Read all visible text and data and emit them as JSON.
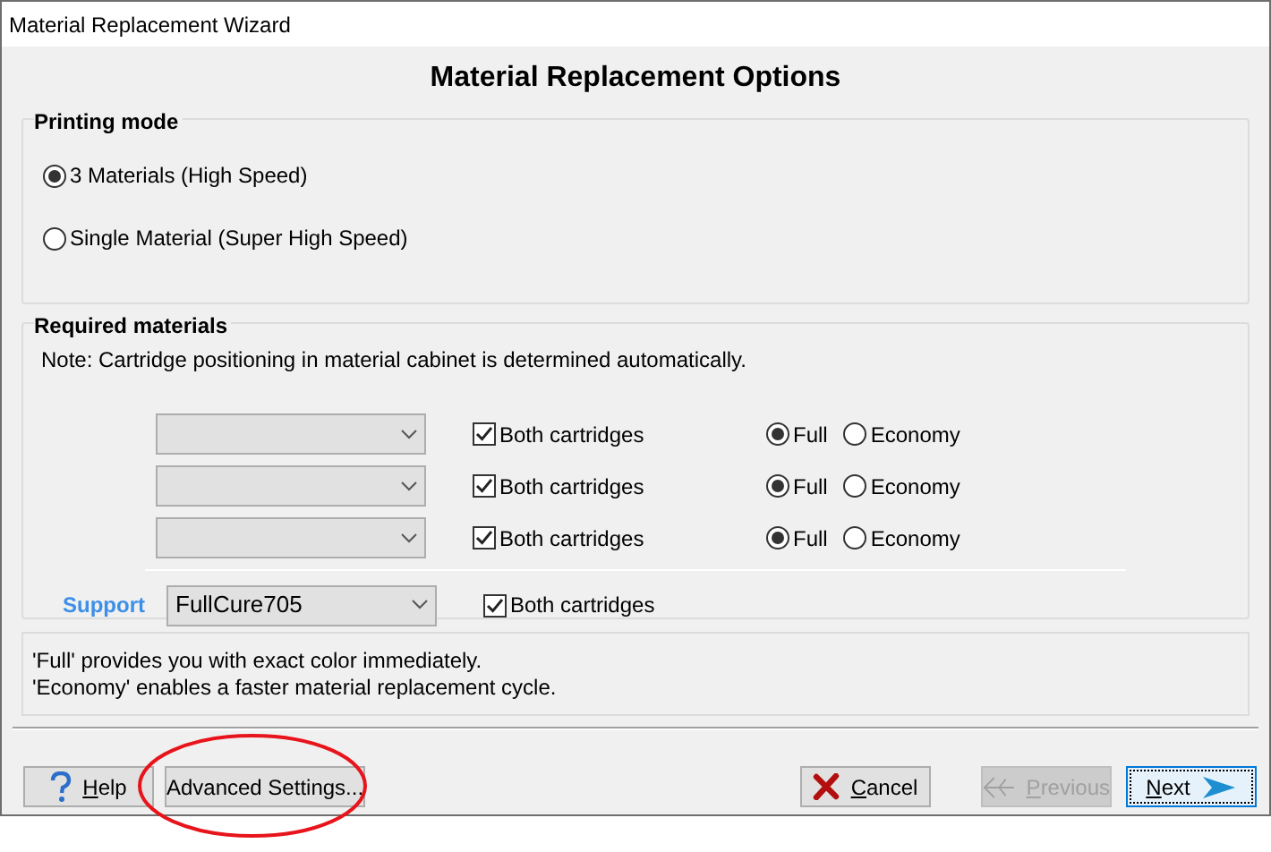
{
  "window": {
    "title": "Material Replacement Wizard"
  },
  "heading": "Material Replacement Options",
  "printing_mode": {
    "title": "Printing mode",
    "options": [
      {
        "label": "3 Materials (High Speed)",
        "selected": true
      },
      {
        "label": "Single Material (Super High Speed)",
        "selected": false
      }
    ]
  },
  "required_materials": {
    "title": "Required materials",
    "note": "Note: Cartridge positioning in material cabinet is determined automatically.",
    "rows": [
      {
        "kind": "model",
        "both_cartridges": {
          "label": "Both cartridges",
          "checked": true
        },
        "modes": [
          {
            "label": "Full",
            "selected": true
          },
          {
            "label": "Economy",
            "selected": false
          }
        ]
      },
      {
        "kind": "model",
        "both_cartridges": {
          "label": "Both cartridges",
          "checked": true
        },
        "modes": [
          {
            "label": "Full",
            "selected": true
          },
          {
            "label": "Economy",
            "selected": false
          }
        ]
      },
      {
        "kind": "model",
        "both_cartridges": {
          "label": "Both cartridges",
          "checked": true
        },
        "modes": [
          {
            "label": "Full",
            "selected": true
          },
          {
            "label": "Economy",
            "selected": false
          }
        ]
      },
      {
        "kind": "support",
        "label": "Support",
        "value": "FullCure705",
        "both_cartridges": {
          "label": "Both cartridges",
          "checked": true
        }
      }
    ]
  },
  "info": [
    "'Full' provides you with exact color immediately.",
    "'Economy' enables a faster material replacement cycle."
  ],
  "buttons": [
    {
      "kind": "help",
      "label": "Help",
      "disabled": false,
      "focused": false
    },
    {
      "kind": "advanced",
      "label": "Advanced Settings...",
      "disabled": false,
      "focused": false,
      "circled": true
    },
    {
      "kind": "cancel",
      "label": "Cancel",
      "disabled": false,
      "focused": false
    },
    {
      "kind": "previous",
      "label": "Previous",
      "disabled": true,
      "focused": false
    },
    {
      "kind": "next",
      "label": "Next",
      "disabled": false,
      "focused": true
    }
  ]
}
